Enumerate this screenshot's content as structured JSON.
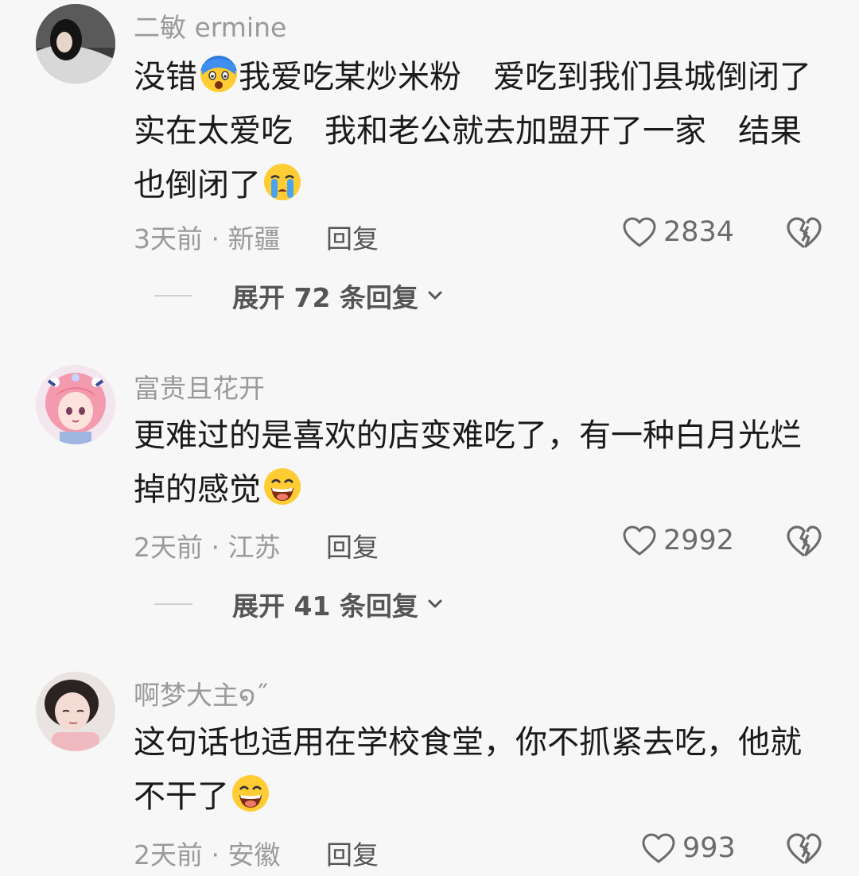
{
  "comments": [
    {
      "username": "二敏 ermine",
      "lines": [
        "没错",
        "我爱吃某炒米粉　爱吃到我们县城倒闭了",
        "实在太爱吃　我和老公就去加盟开了一家　结果",
        "也倒闭了"
      ],
      "meta": "3天前 · 新疆",
      "reply": "回复",
      "likes": "2834",
      "expand": "展开 72 条回复"
    },
    {
      "username": "富贵且花开",
      "lines": [
        "更难过的是喜欢的店变难吃了，有一种白月光烂",
        "掉的感觉"
      ],
      "meta": "2天前 · 江苏",
      "reply": "回复",
      "likes": "2992",
      "expand": "展开 41 条回复"
    },
    {
      "username": "啊梦大主໑˝",
      "lines": [
        "这句话也适用在学校食堂，你不抓紧去吃，他就",
        "不干了"
      ],
      "meta": "2天前 · 安徽",
      "reply": "回复",
      "likes": "993"
    }
  ],
  "icons": {
    "like": "heart-outline-icon",
    "dislike": "broken-heart-icon",
    "expand": "chevron-down-icon",
    "emojis": [
      "scared-emoji",
      "crying-emoji",
      "grinning-emoji",
      "grinning-emoji"
    ]
  },
  "colors": {
    "background": "#f7f7f7",
    "text": "#1a1a1a",
    "secondary": "#9a9a9a",
    "emoji_yellow": "#ffcc33"
  }
}
